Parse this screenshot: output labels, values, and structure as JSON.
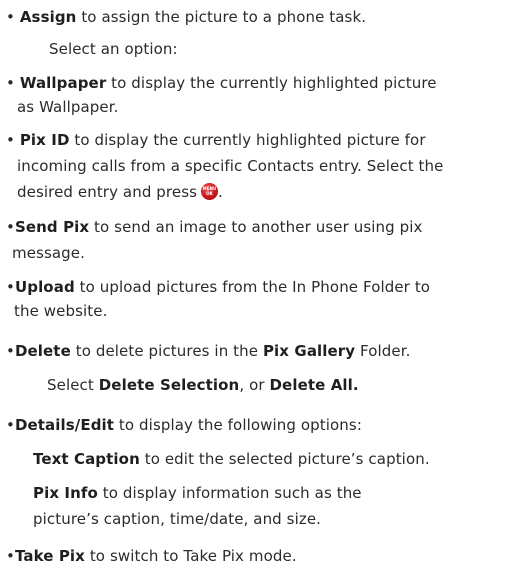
{
  "bullet": "•",
  "items": {
    "assign": {
      "term": "Assign",
      "text": " to assign the picture to a phone task.",
      "sub": "Select an option:"
    },
    "wallpaper": {
      "term": "Wallpaper",
      "line1": " to display the currently highlighted picture",
      "line2": "as Wallpaper."
    },
    "pixid": {
      "term": "Pix ID",
      "line1": " to display the currently highlighted picture for",
      "line2": "incoming calls from a specific Contacts entry. Select the",
      "line3": "desired entry and press",
      "line3_end": ".",
      "key_top": "MENU",
      "key_bottom": "OK"
    },
    "sendpix": {
      "term": "Send Pix",
      "line1": " to send an image to another user using pix",
      "line2": "message."
    },
    "upload": {
      "term": "Upload",
      "line1": " to upload pictures from the In Phone Folder to",
      "line2": "the website."
    },
    "delete": {
      "term": "Delete",
      "text": " to delete pictures in the ",
      "folder": "Pix Gallery",
      "text_end": " Folder.",
      "sub_pre": "Select ",
      "sub_opt1": "Delete Selection",
      "sub_mid": ", or ",
      "sub_opt2": "Delete All."
    },
    "details": {
      "term": "Details/Edit",
      "text": " to display the following options:",
      "caption_term": "Text Caption",
      "caption_text": " to edit the selected picture’s caption.",
      "info_term": "Pix Info",
      "info_line1": " to display information such as the",
      "info_line2": "picture’s caption, time/date, and size."
    },
    "takepix": {
      "term": "Take Pix",
      "text": " to switch to Take Pix mode."
    }
  }
}
